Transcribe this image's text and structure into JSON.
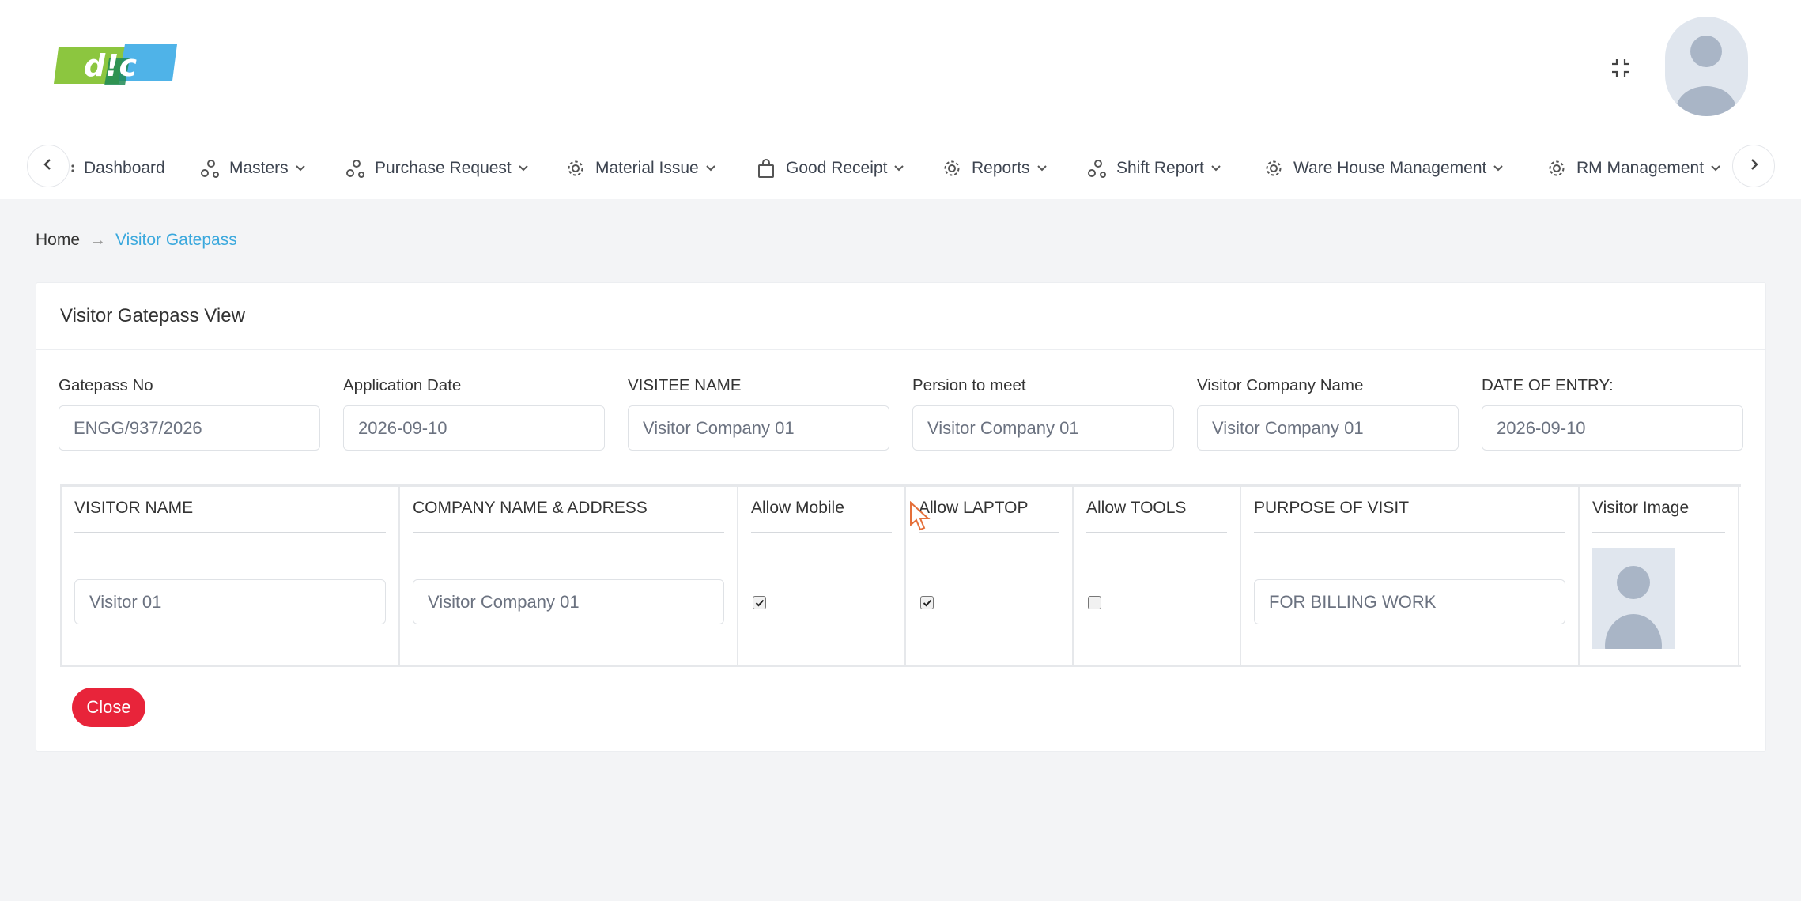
{
  "header": {
    "logo_text": "d!c",
    "compress_icon": "compress-icon",
    "avatar_icon": "user-avatar-icon"
  },
  "nav": {
    "items": [
      {
        "label": "Dashboard",
        "icon": "dashboard-icon",
        "dropdown": false
      },
      {
        "label": "Masters",
        "icon": "nodes-icon",
        "dropdown": true
      },
      {
        "label": "Purchase Request",
        "icon": "nodes-icon",
        "dropdown": true
      },
      {
        "label": "Material Issue",
        "icon": "gear-icon",
        "dropdown": true
      },
      {
        "label": "Good Receipt",
        "icon": "bag-icon",
        "dropdown": true
      },
      {
        "label": "Reports",
        "icon": "gear-icon",
        "dropdown": true
      },
      {
        "label": "Shift Report",
        "icon": "nodes-icon",
        "dropdown": true
      },
      {
        "label": "Ware House Management",
        "icon": "gear-icon",
        "dropdown": true
      },
      {
        "label": "RM Management",
        "icon": "gear-icon",
        "dropdown": true
      }
    ]
  },
  "breadcrumb": {
    "home": "Home",
    "separator": "→",
    "current": "Visitor Gatepass"
  },
  "card": {
    "title": "Visitor Gatepass View",
    "fields": [
      {
        "label": "Gatepass No",
        "value": "ENGG/937/2026"
      },
      {
        "label": "Application Date",
        "value": "2026-09-10"
      },
      {
        "label": "VISITEE NAME",
        "value": "Visitor Company 01"
      },
      {
        "label": "Persion to meet",
        "value": "Visitor Company 01"
      },
      {
        "label": "Visitor Company Name",
        "value": "Visitor Company 01"
      },
      {
        "label": "DATE OF ENTRY:",
        "value": "2026-09-10"
      }
    ],
    "table": {
      "headers": [
        "VISITOR NAME",
        "COMPANY NAME & ADDRESS",
        "Allow Mobile",
        "Allow LAPTOP",
        "Allow TOOLS",
        "PURPOSE OF VISIT",
        "Visitor Image"
      ],
      "row": {
        "visitor_name": "Visitor 01",
        "company": "Visitor Company 01",
        "allow_mobile": true,
        "allow_laptop": true,
        "allow_tools": false,
        "purpose": "FOR BILLING WORK"
      }
    },
    "close_label": "Close"
  },
  "colors": {
    "accent": "#3aa8dd",
    "danger": "#e8243a",
    "logo_green": "#8cc63f",
    "logo_blue": "#4fb3e8"
  }
}
